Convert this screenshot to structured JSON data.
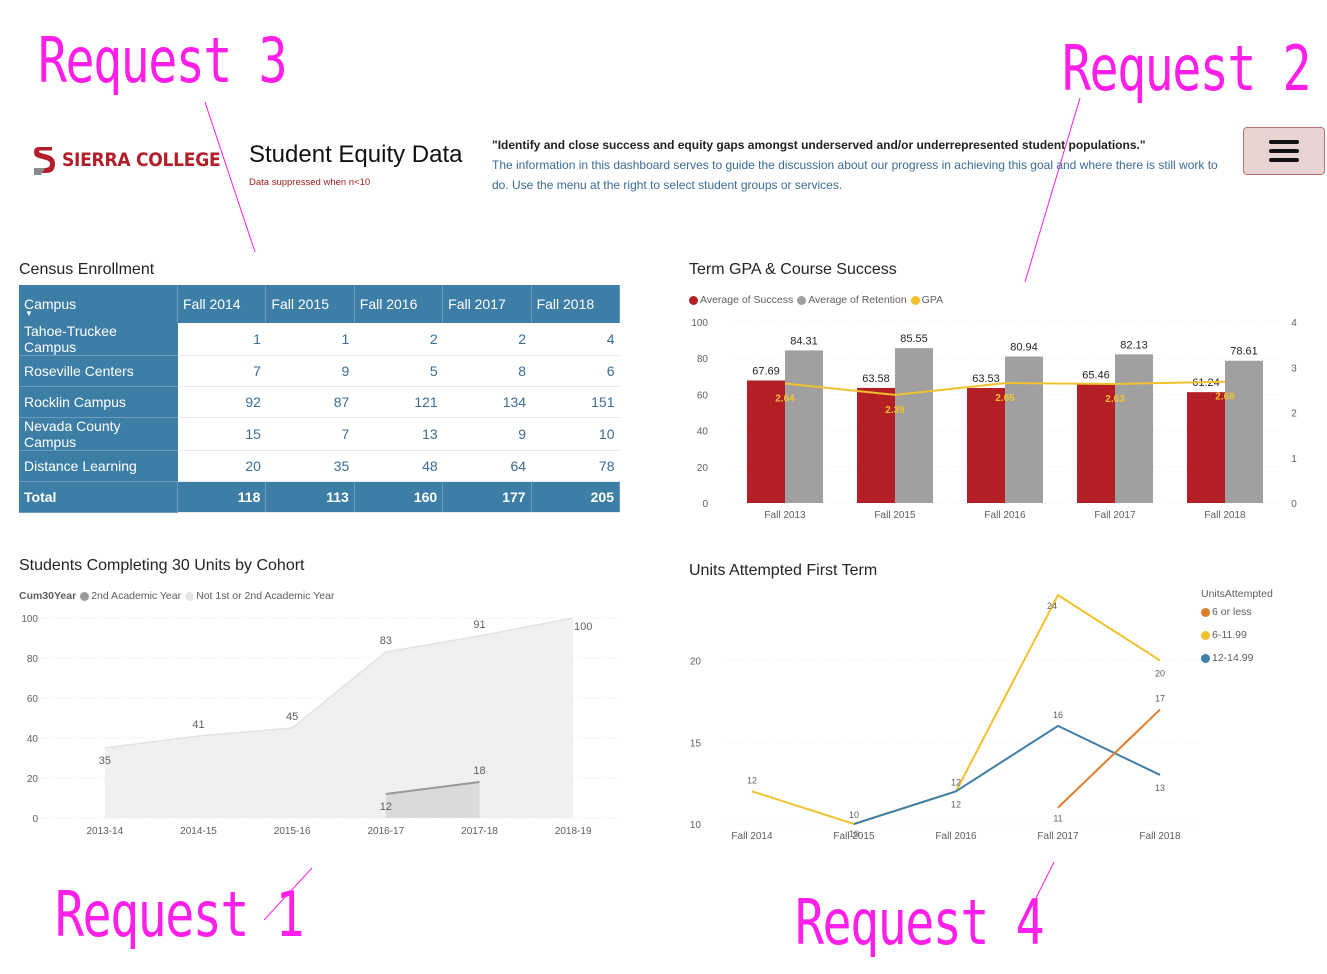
{
  "annotations": {
    "request1": "Request 1",
    "request2": "Request 2",
    "request3": "Request 3",
    "request4": "Request 4"
  },
  "header": {
    "logo_text": "SIERRA COLLEGE",
    "title": "Student Equity Data",
    "suppression_note": "Data suppressed when n<10",
    "quote": "\"Identify and close success and equity gaps amongst underserved and/or underrepresented student populations.\"",
    "description": "The information in this dashboard serves to guide the discussion about our progress in achieving this goal and where there is still work to do.  Use the menu at the right to select student groups or services.",
    "menu_icon": "hamburger-menu-icon"
  },
  "census": {
    "title": "Census Enrollment",
    "columns": [
      "Campus",
      "Fall 2014",
      "Fall 2015",
      "Fall 2016",
      "Fall 2017",
      "Fall 2018"
    ],
    "rows": [
      {
        "campus": "Tahoe-Truckee Campus",
        "values": [
          "1",
          "1",
          "2",
          "2",
          "4"
        ]
      },
      {
        "campus": "Roseville Centers",
        "values": [
          "7",
          "9",
          "5",
          "8",
          "6"
        ]
      },
      {
        "campus": "Rocklin Campus",
        "values": [
          "92",
          "87",
          "121",
          "134",
          "151"
        ]
      },
      {
        "campus": "Nevada County Campus",
        "values": [
          "15",
          "7",
          "13",
          "9",
          "10"
        ]
      },
      {
        "campus": "Distance Learning",
        "values": [
          "20",
          "35",
          "48",
          "64",
          "78"
        ]
      }
    ],
    "total": {
      "label": "Total",
      "values": [
        "118",
        "113",
        "160",
        "177",
        "205"
      ]
    }
  },
  "colors": {
    "success": "#b31f24",
    "retention": "#a0a0a0",
    "gpa": "#f2c12e",
    "orange": "#e07e2c",
    "yellow": "#f2c12e",
    "blue": "#3f7ea6",
    "table_header": "#3d7ea6",
    "annotation": "#ff1fe9"
  },
  "chart_data": [
    {
      "id": "term-gpa",
      "type": "bar",
      "title": "Term GPA & Course Success",
      "legend": [
        "Average of Success",
        "Average of Retention",
        "GPA"
      ],
      "categories": [
        "Fall 2013",
        "Fall 2015",
        "Fall 2016",
        "Fall 2017",
        "Fall 2018"
      ],
      "series": [
        {
          "name": "Average of Success",
          "values": [
            67.69,
            63.58,
            63.53,
            65.46,
            61.24
          ]
        },
        {
          "name": "Average of Retention",
          "values": [
            84.31,
            85.55,
            80.94,
            82.13,
            78.61
          ]
        },
        {
          "name": "GPA",
          "type": "line",
          "axis": "secondary",
          "values": [
            2.64,
            2.39,
            2.65,
            2.63,
            2.68
          ]
        }
      ],
      "ylim": [
        0,
        100
      ],
      "yticks": [
        "0",
        "20",
        "40",
        "60",
        "80",
        "100"
      ],
      "y2lim": [
        0,
        4
      ],
      "y2ticks": [
        "0",
        "1",
        "2",
        "3",
        "4"
      ]
    },
    {
      "id": "cum30",
      "type": "area",
      "title": "Students Completing 30 Units by Cohort",
      "legend_title": "Cum30Year",
      "legend": [
        "2nd Academic Year",
        "Not 1st or 2nd Academic Year"
      ],
      "categories": [
        "2013-14",
        "2014-15",
        "2015-16",
        "2016-17",
        "2017-18",
        "2018-19"
      ],
      "series": [
        {
          "name": "Not 1st or 2nd Academic Year",
          "values": [
            35,
            41,
            45,
            83,
            91,
            100
          ]
        },
        {
          "name": "2nd Academic Year",
          "values": [
            null,
            null,
            null,
            12,
            18,
            null
          ]
        }
      ],
      "ylim": [
        0,
        100
      ],
      "yticks": [
        "0",
        "20",
        "40",
        "60",
        "80",
        "100"
      ]
    },
    {
      "id": "units-attempted",
      "type": "line",
      "title": "Units Attempted First Term",
      "legend_title": "UnitsAttempted",
      "legend": [
        "6 or less",
        "6-11.99",
        "12-14.99"
      ],
      "categories": [
        "Fall 2014",
        "Fall 2015",
        "Fall 2016",
        "Fall 2017",
        "Fall 2018"
      ],
      "series": [
        {
          "name": "6 or less",
          "values": [
            null,
            null,
            null,
            11,
            17
          ]
        },
        {
          "name": "6-11.99",
          "values": [
            12,
            10,
            12,
            24,
            20
          ]
        },
        {
          "name": "12-14.99",
          "values": [
            null,
            10,
            12,
            16,
            13
          ]
        }
      ],
      "ylim": [
        10,
        24
      ],
      "yticks": [
        "10",
        "15",
        "20"
      ]
    }
  ]
}
